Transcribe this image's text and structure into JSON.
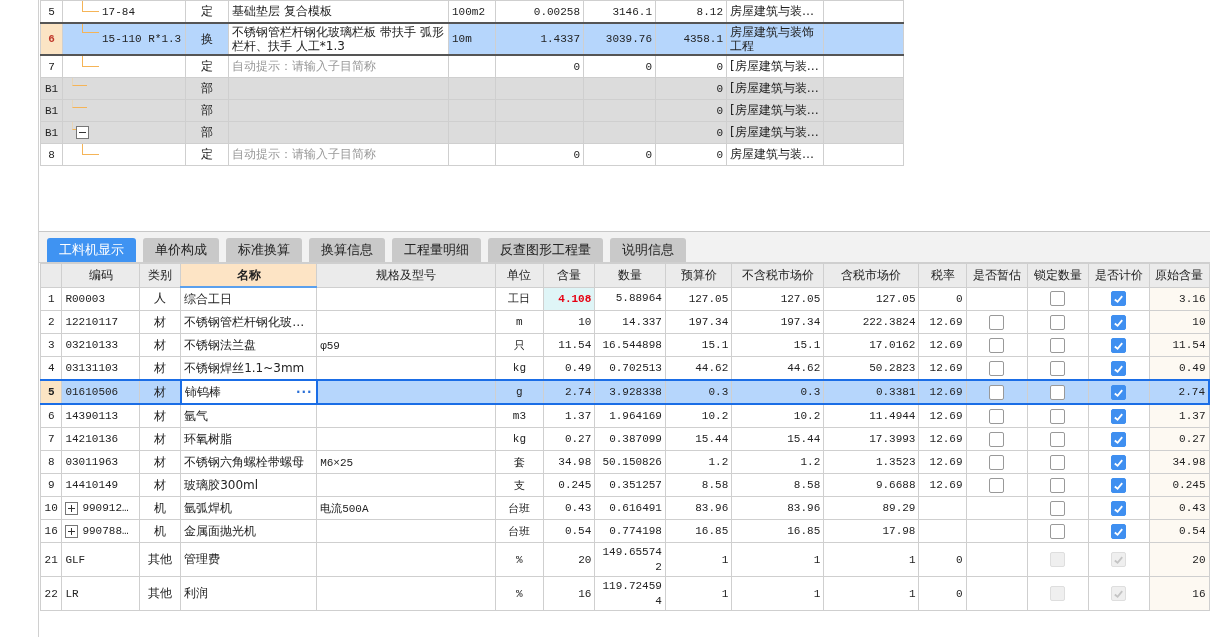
{
  "top_grid": {
    "rows": [
      {
        "no": "5",
        "code": "17-84",
        "type": "定",
        "name": "基础垫层 复合模板",
        "unit": "100m2",
        "qty": "0.00258",
        "price": "3146.1",
        "total": "8.12",
        "desc": "房屋建筑与装…",
        "kind": "item",
        "selected": false
      },
      {
        "no": "6",
        "code": "15-110 R*1.3",
        "type": "换",
        "name": "不锈钢管栏杆钢化玻璃栏板 带扶手  弧形栏杆、扶手 人工*1.3",
        "unit": "10m",
        "qty": "1.4337",
        "price": "3039.76",
        "total": "4358.1",
        "desc": "房屋建筑与装饰工程",
        "kind": "item",
        "selected": true
      },
      {
        "no": "7",
        "type": "定",
        "placeholder": "自动提示：请输入子目简称",
        "qty": "0",
        "price": "0",
        "total": "0",
        "desc": "[房屋建筑与装…",
        "kind": "item",
        "selected": false
      },
      {
        "no": "B1",
        "type": "部",
        "total": "0",
        "desc": "[房屋建筑与装…",
        "kind": "division",
        "selected": false
      },
      {
        "no": "B1",
        "type": "部",
        "total": "0",
        "desc": "[房屋建筑与装…",
        "kind": "division",
        "selected": false
      },
      {
        "no": "B1",
        "type": "部",
        "total": "0",
        "desc": "[房屋建筑与装…",
        "kind": "division",
        "selected": false,
        "expanded": true
      },
      {
        "no": "8",
        "type": "定",
        "placeholder": "自动提示：请输入子目简称",
        "qty": "0",
        "price": "0",
        "total": "0",
        "desc": "房屋建筑与装…",
        "kind": "item",
        "selected": false
      }
    ]
  },
  "tabs": [
    {
      "label": "工料机显示",
      "selected": true
    },
    {
      "label": "单价构成",
      "selected": false
    },
    {
      "label": "标准换算",
      "selected": false
    },
    {
      "label": "换算信息",
      "selected": false
    },
    {
      "label": "工程量明细",
      "selected": false
    },
    {
      "label": "反查图形工程量",
      "selected": false
    },
    {
      "label": "说明信息",
      "selected": false
    }
  ],
  "material_grid": {
    "columns": [
      {
        "label": "编码",
        "selected": false
      },
      {
        "label": "类别",
        "selected": false
      },
      {
        "label": "名称",
        "selected": true
      },
      {
        "label": "规格及型号",
        "selected": false
      },
      {
        "label": "单位",
        "selected": false
      },
      {
        "label": "含量",
        "selected": false
      },
      {
        "label": "数量",
        "selected": false
      },
      {
        "label": "预算价",
        "selected": false
      },
      {
        "label": "不含税市场价",
        "selected": false
      },
      {
        "label": "含税市场价",
        "selected": false
      },
      {
        "label": "税率",
        "selected": false
      },
      {
        "label": "是否暂估",
        "selected": false
      },
      {
        "label": "锁定数量",
        "selected": false
      },
      {
        "label": "是否计价",
        "selected": false
      },
      {
        "label": "原始含量",
        "selected": false
      }
    ],
    "rows": [
      {
        "no": "1",
        "code": "R00003",
        "type": "人",
        "name": "综合工日",
        "unit": "工日",
        "content": "4.108",
        "modified": true,
        "qty": "5.88964",
        "budget": "127.05",
        "price_ex": "127.05",
        "price_inc": "127.05",
        "tax": "0",
        "locked": false,
        "priced": true,
        "disabled": false,
        "original": "3.16",
        "selected": false
      },
      {
        "no": "2",
        "code": "12210117",
        "type": "材",
        "name": "不锈钢管栏杆钢化玻…",
        "unit": "m",
        "content": "10",
        "modified": false,
        "qty": "14.337",
        "budget": "197.34",
        "price_ex": "197.34",
        "price_inc": "222.3824",
        "tax": "12.69",
        "estimate": false,
        "locked": false,
        "priced": true,
        "disabled": false,
        "original": "10",
        "selected": false
      },
      {
        "no": "3",
        "code": "03210133",
        "type": "材",
        "name": "不锈钢法兰盘",
        "spec": "φ59",
        "unit": "只",
        "content": "11.54",
        "modified": false,
        "qty": "16.544898",
        "budget": "15.1",
        "price_ex": "15.1",
        "price_inc": "17.0162",
        "tax": "12.69",
        "estimate": false,
        "locked": false,
        "priced": true,
        "disabled": false,
        "original": "11.54",
        "selected": false
      },
      {
        "no": "4",
        "code": "03131103",
        "type": "材",
        "name": "不锈钢焊丝1.1~3mm",
        "unit": "kg",
        "content": "0.49",
        "modified": false,
        "qty": "0.702513",
        "budget": "44.62",
        "price_ex": "44.62",
        "price_inc": "50.2823",
        "tax": "12.69",
        "estimate": false,
        "locked": false,
        "priced": true,
        "disabled": false,
        "original": "0.49",
        "selected": false
      },
      {
        "no": "5",
        "code": "01610506",
        "type": "材",
        "name": "铈钨棒",
        "button": "···",
        "unit": "g",
        "content": "2.74",
        "modified": false,
        "qty": "3.928338",
        "budget": "0.3",
        "price_ex": "0.3",
        "price_inc": "0.3381",
        "tax": "12.69",
        "estimate": false,
        "locked": false,
        "priced": true,
        "disabled": false,
        "original": "2.74",
        "selected": true
      },
      {
        "no": "6",
        "code": "14390113",
        "type": "材",
        "name": "氩气",
        "unit": "m3",
        "content": "1.37",
        "modified": false,
        "qty": "1.964169",
        "budget": "10.2",
        "price_ex": "10.2",
        "price_inc": "11.4944",
        "tax": "12.69",
        "estimate": false,
        "locked": false,
        "priced": true,
        "disabled": false,
        "original": "1.37",
        "selected": false
      },
      {
        "no": "7",
        "code": "14210136",
        "type": "材",
        "name": "环氧树脂",
        "unit": "kg",
        "content": "0.27",
        "modified": false,
        "qty": "0.387099",
        "budget": "15.44",
        "price_ex": "15.44",
        "price_inc": "17.3993",
        "tax": "12.69",
        "estimate": false,
        "locked": false,
        "priced": true,
        "disabled": false,
        "original": "0.27",
        "selected": false
      },
      {
        "no": "8",
        "code": "03011963",
        "type": "材",
        "name": "不锈钢六角螺栓带螺母",
        "spec": "M6×25",
        "unit": "套",
        "content": "34.98",
        "modified": false,
        "qty": "50.150826",
        "budget": "1.2",
        "price_ex": "1.2",
        "price_inc": "1.3523",
        "tax": "12.69",
        "estimate": false,
        "locked": false,
        "priced": true,
        "disabled": false,
        "original": "34.98",
        "selected": false
      },
      {
        "no": "9",
        "code": "14410149",
        "type": "材",
        "name": "玻璃胶300ml",
        "unit": "支",
        "content": "0.245",
        "modified": false,
        "qty": "0.351257",
        "budget": "8.58",
        "price_ex": "8.58",
        "price_inc": "9.6688",
        "tax": "12.69",
        "estimate": false,
        "locked": false,
        "priced": true,
        "disabled": false,
        "original": "0.245",
        "selected": false
      },
      {
        "no": "10",
        "code": "990912…",
        "expanded": false,
        "type": "机",
        "name": "氩弧焊机",
        "spec": "电流500A",
        "unit": "台班",
        "content": "0.43",
        "modified": false,
        "qty": "0.616491",
        "budget": "83.96",
        "price_ex": "83.96",
        "price_inc": "89.29",
        "locked": false,
        "priced": true,
        "disabled": false,
        "original": "0.43",
        "selected": false
      },
      {
        "no": "16",
        "code": "990788…",
        "expanded": false,
        "type": "机",
        "name": "金属面抛光机",
        "unit": "台班",
        "content": "0.54",
        "modified": false,
        "qty": "0.774198",
        "budget": "16.85",
        "price_ex": "16.85",
        "price_inc": "17.98",
        "locked": false,
        "priced": true,
        "disabled": false,
        "original": "0.54",
        "selected": false
      },
      {
        "no": "21",
        "code": "GLF",
        "type": "其他",
        "name": "管理费",
        "unit": "%",
        "content": "20",
        "modified": false,
        "qty": "149.655742",
        "budget": "1",
        "price_ex": "1",
        "price_inc": "1",
        "tax": "0",
        "locked": false,
        "priced": true,
        "disabled": true,
        "original": "20",
        "selected": false
      },
      {
        "no": "22",
        "code": "LR",
        "type": "其他",
        "name": "利润",
        "unit": "%",
        "content": "16",
        "modified": false,
        "qty": "119.724594",
        "budget": "1",
        "price_ex": "1",
        "price_inc": "1",
        "tax": "0",
        "locked": false,
        "priced": true,
        "disabled": true,
        "original": "16",
        "selected": false
      }
    ]
  }
}
